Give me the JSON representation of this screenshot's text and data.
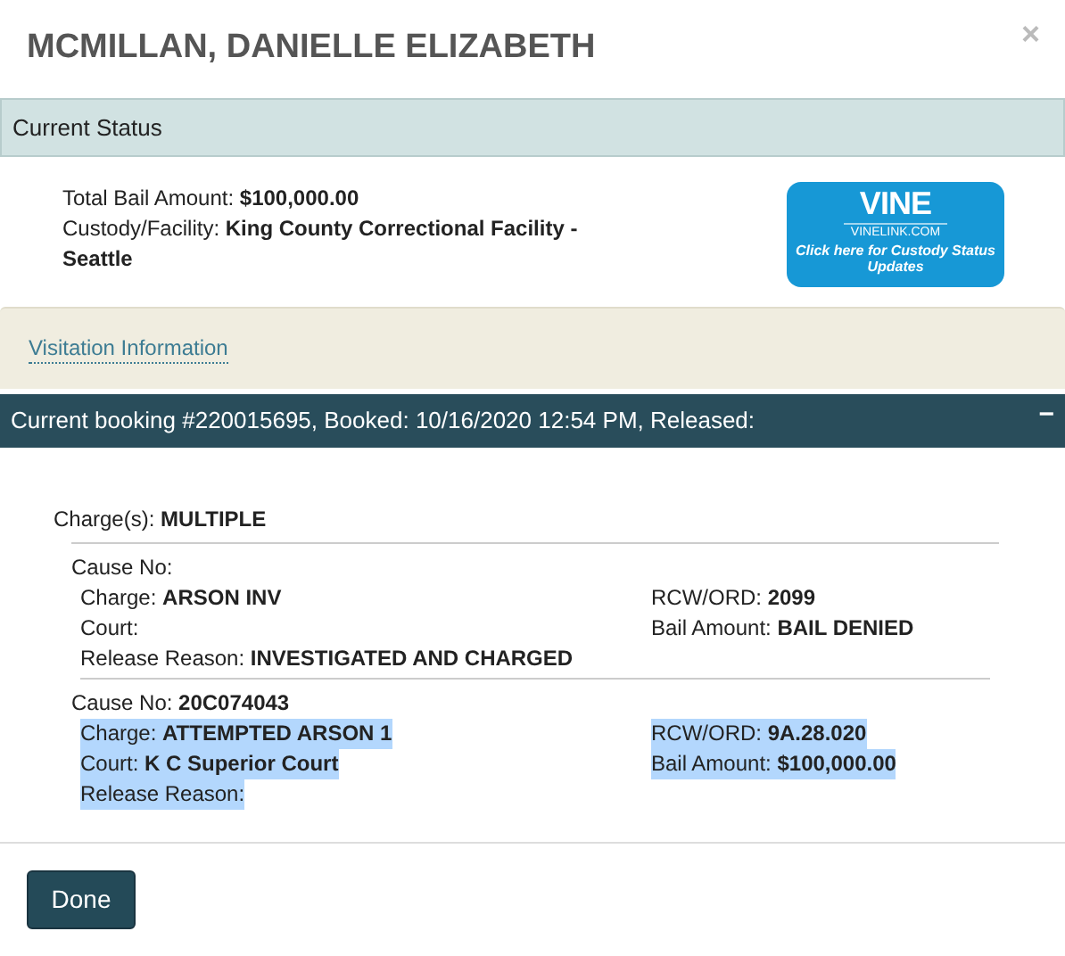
{
  "title": "MCMILLAN, DANIELLE ELIZABETH",
  "close": "×",
  "status_header": "Current Status",
  "status_lines": [
    "Total Bail Amount: **$100,000.00**",
    "Custody/Facility: **King County Correctional Facility - Seattle**"
  ],
  "vine_banner": {
    "brand": "VINE",
    "site": "VINELINK.COM",
    "caption": "Click here for Custody Status Updates"
  },
  "visitation_link": "Visitation Information",
  "booking": {
    "header": "Current booking #220015695, Booked: 10/16/2020 12:54 PM, Released:",
    "toggle": "−"
  },
  "charges_summary": "Charge(s): **MULTIPLE**",
  "charges": [
    {
      "cause": "Cause No:",
      "highlighted": false,
      "left": [
        "Charge: **ARSON INV**",
        "Court:",
        "Release Reason: **INVESTIGATED AND CHARGED**"
      ],
      "right": [
        "RCW/ORD: **2099**",
        "Bail Amount: **BAIL DENIED**"
      ]
    },
    {
      "cause": "Cause No: **20C074043**",
      "highlighted": true,
      "left": [
        "Charge: **ATTEMPTED ARSON 1**",
        "Court: **K C Superior Court**",
        "Release Reason:"
      ],
      "right": [
        "RCW/ORD: **9A.28.020**",
        "Bail Amount: **$100,000.00**"
      ]
    }
  ],
  "done_button": "Done"
}
